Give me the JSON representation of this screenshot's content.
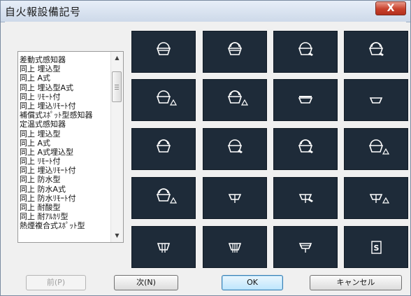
{
  "window": {
    "title": "自火報設備記号",
    "close_label": "X"
  },
  "list": {
    "items": [
      "差動式感知器",
      "同上 埋込型",
      "同上 A式",
      "同上 埋込型A式",
      "同上 ﾘﾓｰﾄ付",
      "同上 埋込ﾘﾓｰﾄ付",
      "補償式ｽﾎﾟｯﾄ型感知器",
      "定温式感知器",
      "同上 埋込型",
      "同上 A式",
      "同上 A式埋込型",
      "同上 ﾘﾓｰﾄ付",
      "同上 埋込ﾘﾓｰﾄ付",
      "同上 防水型",
      "同上 防水A式",
      "同上 防水ﾘﾓｰﾄ付",
      "同上 耐酸型",
      "同上 耐ｱﾙｶﾘ型",
      "熱煙複合式ｽﾎﾟｯﾄ型"
    ]
  },
  "symbols": [
    "diff-spot",
    "diff-embedded",
    "diff-a-type",
    "diff-embedded-a",
    "diff-remote",
    "diff-embedded-remote",
    "compensated-spot",
    "fixed-temp",
    "fixed-embedded",
    "fixed-a-type",
    "fixed-a-embedded",
    "fixed-remote",
    "fixed-embedded-remote",
    "fixed-waterproof",
    "fixed-waterproof-a",
    "fixed-waterproof-remote",
    "fixed-acid-proof",
    "fixed-alkali-proof",
    "heat-smoke-combined",
    "smoke-symbol-s"
  ],
  "buttons": {
    "prev": "前(P)",
    "next": "次(N)",
    "ok": "OK",
    "cancel": "キャンセル"
  },
  "colors": {
    "tile_bg": "#1e2b39",
    "glyph": "#ffffff"
  }
}
